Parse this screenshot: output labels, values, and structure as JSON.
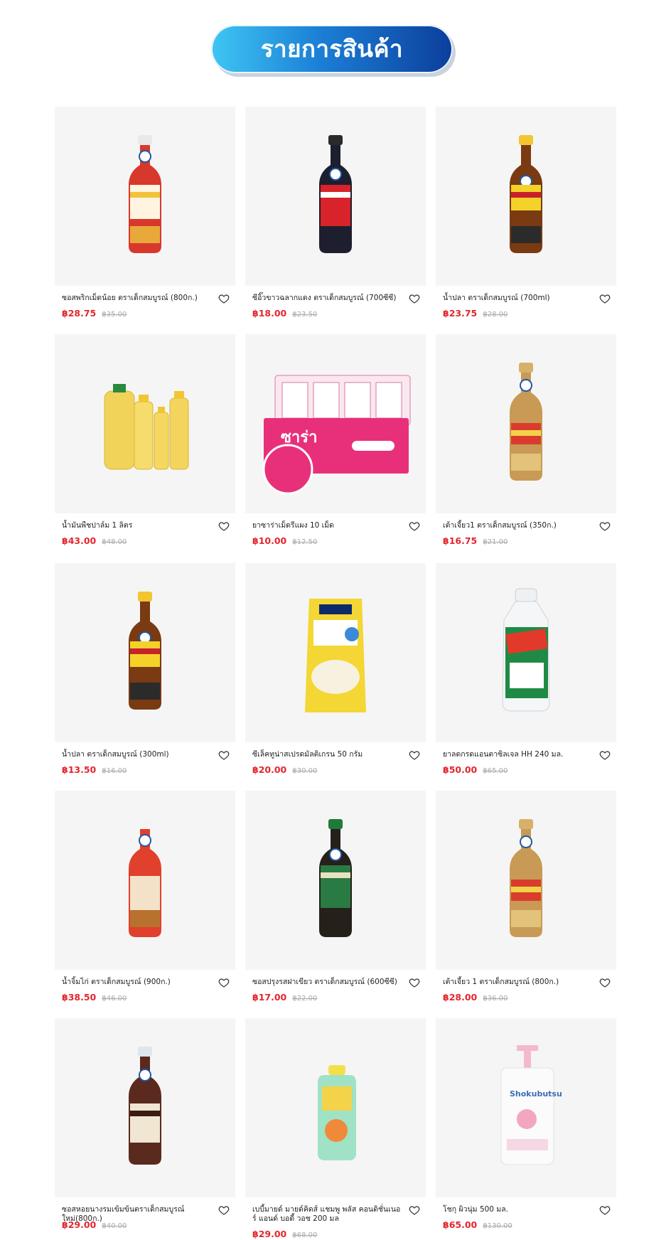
{
  "page": {
    "title": "รายการสินค้า"
  },
  "products": [
    {
      "name": "ซอสพริกเม็ดน้อย ตราเด็กสมบูรณ์ (800ก.)",
      "price": "฿28.75",
      "old_price": "฿35.00",
      "image": "red-sauce-bottle"
    },
    {
      "name": "ซีอิ๊วขาวฉลากแดง ตราเด็กสมบูรณ์ (700ซีซี)",
      "price": "฿18.00",
      "old_price": "฿23.50",
      "image": "dark-soy-bottle"
    },
    {
      "name": "น้ำปลา ตราเด็กสมบูรณ์ (700ml)",
      "price": "฿23.75",
      "old_price": "฿28.00",
      "image": "fish-sauce-bottle"
    },
    {
      "name": "น้ำมันพืชปาล์ม 1 ลิตร",
      "price": "฿43.00",
      "old_price": "฿48.00",
      "image": "palm-oil-bottles"
    },
    {
      "name": "ยาซาร่าเม็ดรีแผง 10 เม็ด",
      "price": "฿10.00",
      "old_price": "฿12.50",
      "image": "sara-tablet-box"
    },
    {
      "name": "เต้าเจี้ยว1 ตราเด็กสมบูรณ์ (350ก.)",
      "price": "฿16.75",
      "old_price": "฿21.00",
      "image": "soybean-paste-bottle"
    },
    {
      "name": "น้ำปลา ตราเด็กสมบูรณ์ (300ml)",
      "price": "฿13.50",
      "old_price": "฿16.00",
      "image": "fish-sauce-bottle"
    },
    {
      "name": "ซีเล็คทูน่าสเปรดมัลติเกรน 50 กรัม",
      "price": "฿20.00",
      "old_price": "฿30.00",
      "image": "tuna-spread-pack"
    },
    {
      "name": "ยาลดกรดแอนตาซิลเจล HH 240 มล.",
      "price": "฿50.00",
      "old_price": "฿65.00",
      "image": "antacil-gel-bottle"
    },
    {
      "name": "น้ำจิ้มไก่ ตราเด็กสมบูรณ์ (900ก.)",
      "price": "฿38.50",
      "old_price": "฿46.00",
      "image": "chicken-sauce-bottle"
    },
    {
      "name": "ซอสปรุงรสฝาเขียว ตราเด็กสมบูรณ์ (600ซีซี)",
      "price": "฿17.00",
      "old_price": "฿22.00",
      "image": "seasoning-sauce-bottle"
    },
    {
      "name": "เต้าเจี้ยว 1 ตราเด็กสมบูรณ์ (800ก.)",
      "price": "฿28.00",
      "old_price": "฿36.00",
      "image": "soybean-paste-bottle"
    },
    {
      "name": "ซอสหอยนางรมเข้มข้นตราเด็กสมบูรณ์ ใหม่(800ก.)",
      "price": "฿29.00",
      "old_price": "฿40.00",
      "image": "oyster-sauce-bottle"
    },
    {
      "name": "เบบี้มายด์ มายด์คิดส์ แชมพู พลัส คอนดิชั่นเนอร์ แอนด์ บอดี้ วอช 200 มล",
      "price": "฿29.00",
      "old_price": "฿68.00",
      "image": "kids-shampoo-bottle"
    },
    {
      "name": "โชกุ ผิวนุ่ม 500 มล.",
      "price": "฿65.00",
      "old_price": "฿130.00",
      "image": "shokubutsu-pump-bottle"
    }
  ],
  "colors": {
    "price": "#e4262d",
    "old_price": "#a9a9a9",
    "banner_start": "#3fc6f3",
    "banner_end": "#0c3e9c"
  }
}
